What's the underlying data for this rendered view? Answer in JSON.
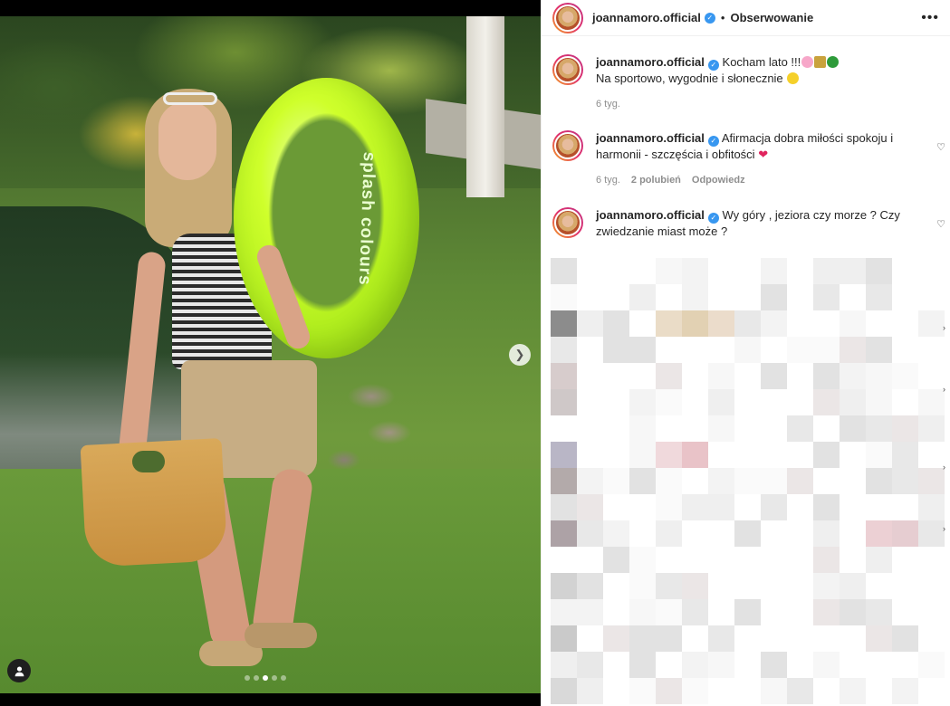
{
  "post": {
    "account": "joannamoro.official",
    "separator": "•",
    "follow_label": "Obserwowanie",
    "more_label": "•••",
    "verified_mark": "✓",
    "caption": {
      "line1": "Kocham lato !!!",
      "line2": "Na sportowo, wygodnie i słonecznie",
      "time": "6 tyg."
    }
  },
  "comments": [
    {
      "user": "joannamoro.official",
      "text": "Afirmacja dobra miłości spokoju i harmonii - szczęścia i obfitości",
      "time": "6 tyg.",
      "likes": "2 polubień",
      "reply_label": "Odpowiedz"
    },
    {
      "user": "joannamoro.official",
      "text": "Wy góry , jeziora czy morze ? Czy zwiedzanie miast może ?"
    }
  ],
  "photo": {
    "ring_text": "splash colours",
    "next_icon": "chevron-right-icon",
    "tag_icon": "user-tag-icon",
    "carousel_active_index": 3,
    "carousel_count": 5
  },
  "colors": {
    "accent_verified": "#3897f0",
    "heart_red": "#e0245e",
    "ring_green": "#c6f527"
  }
}
